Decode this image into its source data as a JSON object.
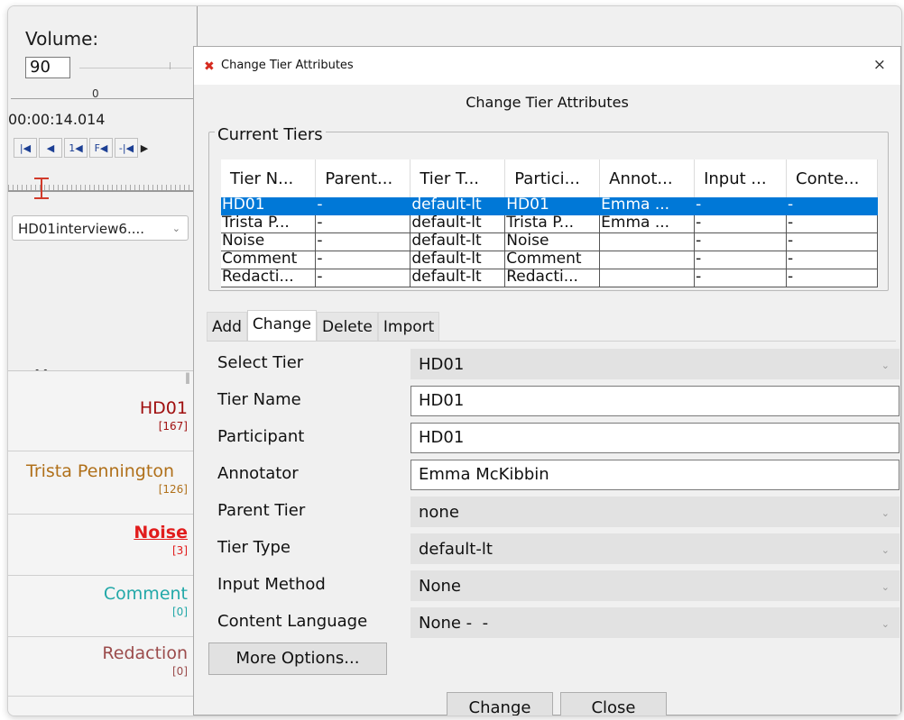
{
  "main_window": {
    "volume_label": "Volume:",
    "volume_value": "90",
    "volume_zero": "0",
    "timecode": "00:00:14.014",
    "transport_icons": [
      "go-to-begin-icon",
      "previous-frame-icon",
      "step-back-icon",
      "frame-back-icon",
      "previous-annotation-icon",
      "play-icon"
    ],
    "transport_glyphs": [
      "|◀",
      "◀",
      "1◀",
      "F◀",
      "-|◀",
      "▶"
    ],
    "document_select": "HD01interview6....",
    "tiers": [
      {
        "name": "HD01",
        "count": "[167]",
        "color": "#a01010",
        "underline": false,
        "bold": false
      },
      {
        "name": "Trista Pennington",
        "count": "[126]",
        "color": "#b0701a",
        "underline": false,
        "bold": false
      },
      {
        "name": "Noise",
        "count": "[3]",
        "color": "#e11c1c",
        "underline": true,
        "bold": true
      },
      {
        "name": "Comment",
        "count": "[0]",
        "color": "#22a8a8",
        "underline": false,
        "bold": false
      },
      {
        "name": "Redaction",
        "count": "[0]",
        "color": "#9b4b4b",
        "underline": false,
        "bold": false
      }
    ]
  },
  "dialog": {
    "window_title": "Change Tier Attributes",
    "heading": "Change Tier Attributes",
    "close_glyph": "×",
    "current_tiers_label": "Current Tiers",
    "columns": [
      "Tier N...",
      "Parent...",
      "Tier T...",
      "Partici...",
      "Annot...",
      "Input ...",
      "Conte..."
    ],
    "rows": [
      [
        "HD01",
        "-",
        "default-lt",
        "HD01",
        "Emma ...",
        "-",
        "-"
      ],
      [
        "Trista P...",
        "-",
        "default-lt",
        "Trista P...",
        "Emma ...",
        "-",
        "-"
      ],
      [
        "Noise",
        "-",
        "default-lt",
        "Noise",
        "",
        "-",
        "-"
      ],
      [
        "Comment",
        "-",
        "default-lt",
        "Comment",
        "",
        "-",
        "-"
      ],
      [
        "Redacti...",
        "-",
        "default-lt",
        "Redacti...",
        "",
        "-",
        "-"
      ]
    ],
    "selected_row": 0,
    "tabs": [
      "Add",
      "Change",
      "Delete",
      "Import"
    ],
    "active_tab": "Change",
    "form": {
      "select_tier_label": "Select Tier",
      "select_tier_value": "HD01",
      "tier_name_label": "Tier Name",
      "tier_name_value": "HD01",
      "participant_label": "Participant",
      "participant_value": "HD01",
      "annotator_label": "Annotator",
      "annotator_value": "Emma McKibbin",
      "parent_tier_label": "Parent Tier",
      "parent_tier_value": "none",
      "tier_type_label": "Tier Type",
      "tier_type_value": "default-lt",
      "input_method_label": "Input Method",
      "input_method_value": "None",
      "content_language_label": "Content Language",
      "content_language_value": "None -  -"
    },
    "more_options_label": "More Options...",
    "change_button": "Change",
    "close_button": "Close",
    "selection_color": "#0078d7"
  }
}
